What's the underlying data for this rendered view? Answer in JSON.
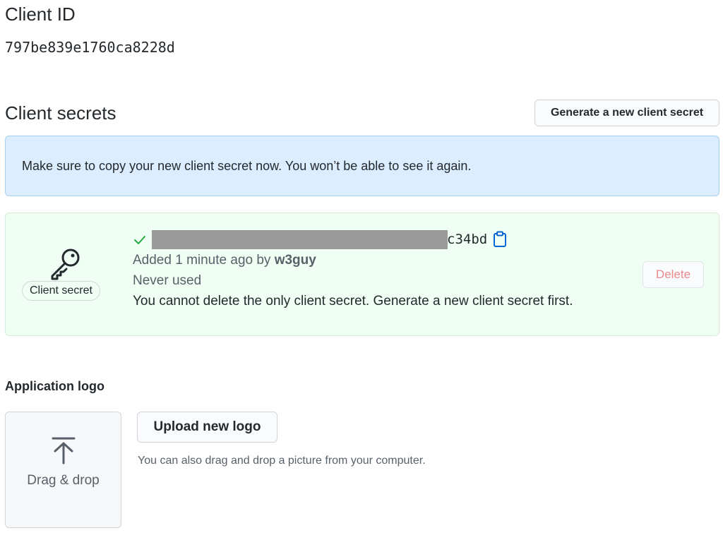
{
  "client_id": {
    "heading": "Client ID",
    "value": "797be839e1760ca8228d"
  },
  "client_secrets": {
    "heading": "Client secrets",
    "generate_button_label": "Generate a new client secret",
    "flash_message": "Make sure to copy your new client secret now. You won’t be able to see it again.",
    "secret": {
      "label": "Client secret",
      "key_icon": "key-icon",
      "check_icon": "check-icon",
      "clipboard_icon": "clipboard-icon",
      "value_suffix": "c34bd",
      "added_prefix": "Added 1 minute ago by ",
      "added_by": "w3guy",
      "usage": "Never used",
      "warning": "You cannot delete the only client secret. Generate a new client secret first.",
      "delete_label": "Delete"
    }
  },
  "application_logo": {
    "heading": "Application logo",
    "upload_icon": "upload-arrow-icon",
    "drop_label": "Drag & drop",
    "upload_button_label": "Upload new logo",
    "hint": "You can also drag and drop a picture from your computer."
  },
  "colors": {
    "info_background": "#dbedff",
    "success_background": "#f0fff4",
    "success_check": "#28a745",
    "danger_disabled": "#ea8a8f",
    "link_blue": "#0366d6"
  }
}
